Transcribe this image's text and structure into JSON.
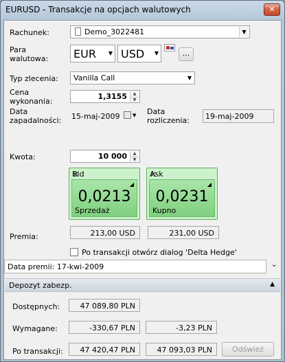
{
  "window": {
    "title": "EURUSD - Transakcje na opcjach walutowych",
    "close_glyph": "✕"
  },
  "account": {
    "label": "Rachunek:",
    "value": "Demo_3022481"
  },
  "pair": {
    "label_line1": "Para",
    "label_line2": "walutowa:",
    "base": "EUR",
    "quote": "USD",
    "more_button": "..."
  },
  "order_type": {
    "label": "Typ zlecenia:",
    "value": "Vanilla Call"
  },
  "strike": {
    "label_line1": "Cena",
    "label_line2": "wykonania:",
    "value": "1,3155"
  },
  "expiry": {
    "label_line1": "Data",
    "label_line2": "zapadalności:",
    "value": "15-maj-2009"
  },
  "settlement": {
    "label_line1": "Data",
    "label_line2": "rozliczenia:",
    "value": "19-maj-2009"
  },
  "amount": {
    "label": "Kwota:",
    "value": "10 000"
  },
  "bid": {
    "title": "Bid",
    "price": "0,0213",
    "action": "Sprzedaż",
    "premium": "213,00 USD"
  },
  "ask": {
    "title": "Ask",
    "price": "0,0231",
    "action": "Kupno",
    "premium": "231,00 USD"
  },
  "premium_label": "Premia:",
  "delta_hedge": {
    "label": "Po transakcji otwórz dialog 'Delta Hedge'",
    "checked": false
  },
  "premium_date": {
    "text": "Data premii: 17-kwi-2009"
  },
  "deposit": {
    "header": "Depozyt zabezp.",
    "available": {
      "label": "Dostępnych:",
      "value": "47 089,80 PLN"
    },
    "required": {
      "label": "Wymagane:",
      "sell": "-330,67 PLN",
      "buy": "-3,23 PLN"
    },
    "after": {
      "label": "Po transakcji:",
      "sell": "47 420,47 PLN",
      "buy": "47 093,03 PLN"
    },
    "refresh_button": "Odśwież"
  }
}
